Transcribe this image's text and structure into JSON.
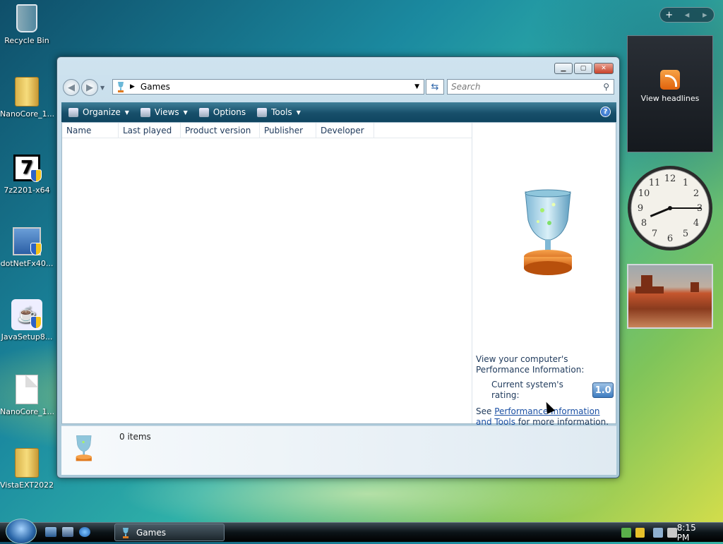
{
  "desktop": {
    "icons": [
      {
        "label": "Recycle Bin",
        "icon": "recycle-bin-icon"
      },
      {
        "label": "NanoCore_1...",
        "icon": "folder-icon"
      },
      {
        "label": "7z2201-x64",
        "icon": "7zip-installer-icon"
      },
      {
        "label": "dotNetFx40...",
        "icon": "dotnet-installer-icon"
      },
      {
        "label": "JavaSetup8...",
        "icon": "java-installer-icon"
      },
      {
        "label": "NanoCore_1...",
        "icon": "document-icon"
      },
      {
        "label": "VistaEXT2022",
        "icon": "folder-icon"
      }
    ]
  },
  "window": {
    "address": "Games",
    "search_placeholder": "Search",
    "toolbar": {
      "organize": "Organize",
      "views": "Views",
      "options": "Options",
      "tools": "Tools"
    },
    "columns": [
      "Name",
      "Last played",
      "Product version",
      "Publisher",
      "Developer"
    ],
    "perf": {
      "intro": "View your computer's Performance Information:",
      "rating_label": "Current system's rating:",
      "rating_value": "1.0",
      "see": "See ",
      "link": "Performance Information and Tools",
      "suffix": " for more information."
    },
    "status": "0 items"
  },
  "sidebar": {
    "feed_label": "View headlines",
    "clock": {
      "hour": 8,
      "minute": 15
    }
  },
  "taskbar": {
    "active_task": "Games",
    "clock": "8:15 PM"
  },
  "colors": {
    "toolbar": "#174f6a",
    "link": "#1a4fa3"
  }
}
